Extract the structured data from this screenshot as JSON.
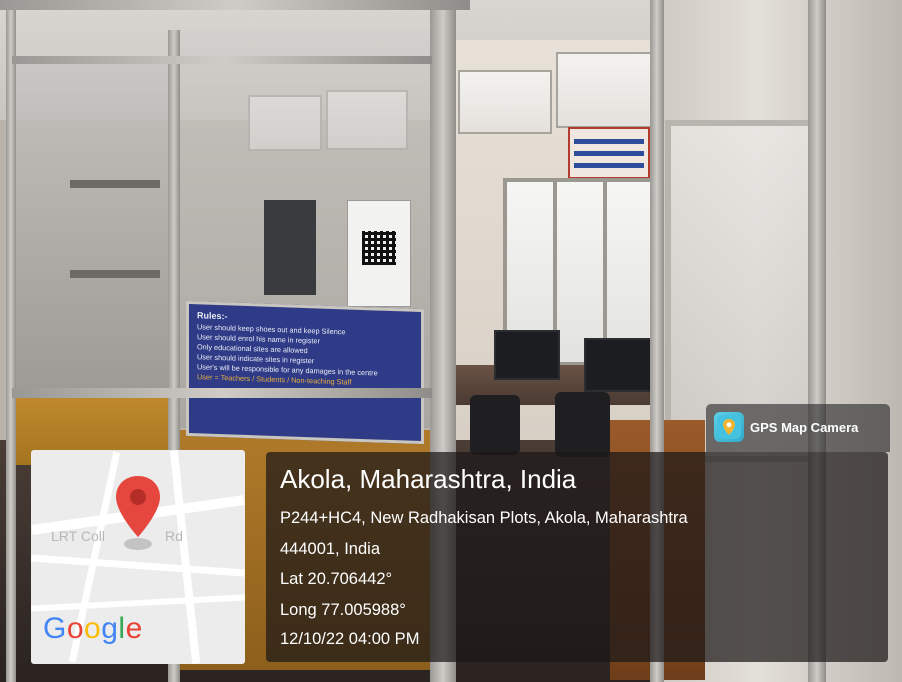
{
  "poster": {
    "title": "Rules:-",
    "items": [
      "User should keep shoes out and keep Silence",
      "User should enrol his name in register",
      "Only educational sites are allowed",
      "User should indicate sites in register",
      "User's will be responsible for any damages in the centre",
      "User = Teachers / Students / Non-teaching Staff"
    ]
  },
  "map": {
    "road_label_left": "LRT Coll",
    "road_label_right": "Rd",
    "provider": "Google",
    "pin_icon": "map-pin-icon"
  },
  "badge": {
    "label": "GPS Map Camera",
    "icon": "gps-map-camera-icon"
  },
  "location": {
    "title": "Akola, Maharashtra, India",
    "address_line1": "P244+HC4, New Radhakisan Plots, Akola, Maharashtra",
    "address_line2": "444001, India",
    "lat": "Lat 20.706442°",
    "long": "Long 77.005988°",
    "datetime": "12/10/22 04:00 PM"
  },
  "colors": {
    "pin": "#e5463e",
    "poster_bg": "#2f3b87",
    "overlay_bg": "rgba(28,24,24,0.72)"
  }
}
